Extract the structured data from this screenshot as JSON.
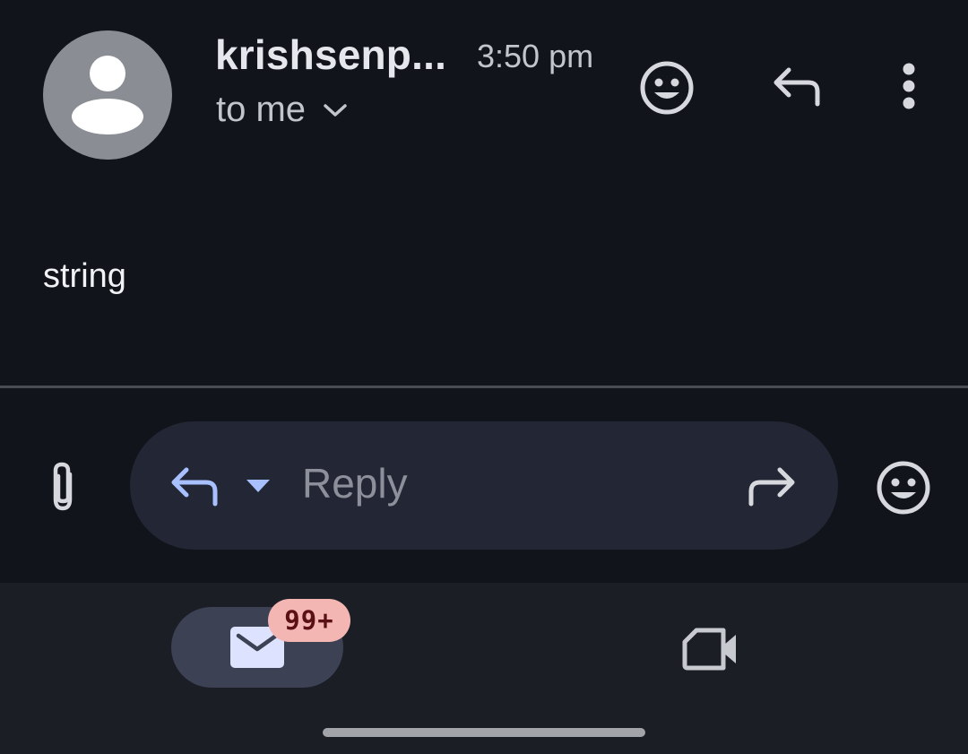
{
  "email": {
    "sender_name": "krishsenp...",
    "time": "3:50 pm",
    "recipient_label": "to me",
    "body": "string"
  },
  "reply_bar": {
    "placeholder": "Reply"
  },
  "bottom_nav": {
    "mail_badge": "99+",
    "items": [
      "mail-icon",
      "video-camera-icon"
    ]
  },
  "icons": {
    "header": [
      "emoji-icon",
      "reply-icon",
      "more-vert-icon"
    ],
    "reply_bar": [
      "attachment-icon",
      "reply-icon",
      "dropdown-icon",
      "forward-icon",
      "emoji-icon"
    ]
  },
  "colors": {
    "background": "#12141c",
    "avatar": "#8a8d93",
    "reply_pill": "#232634",
    "reply_accent": "#a8c0ff",
    "nav_background": "#1c1e26",
    "mail_pill": "#3c4154",
    "badge_background": "#f4b6b2",
    "badge_text": "#5b1113"
  }
}
